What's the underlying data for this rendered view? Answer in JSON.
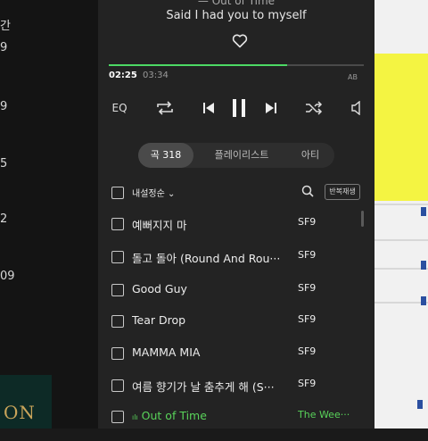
{
  "left_panel": {
    "partial_texts": [
      "간",
      "9",
      "9",
      "5",
      "2",
      "09"
    ],
    "cover_text": "ON"
  },
  "now_playing": {
    "lyric_top": "— Out of Time",
    "lyric": "Said I had you to myself",
    "progress": 0.7,
    "time_current": "02:25",
    "time_total": "03:34",
    "ab_label": "AB"
  },
  "controls": {
    "eq_label": "EQ",
    "icons": [
      "repeat-icon",
      "previous-icon",
      "pause-icon",
      "next-icon",
      "shuffle-icon",
      "volume-icon"
    ]
  },
  "tabs": [
    {
      "label": "곡 318",
      "active": true
    },
    {
      "label": "플레이리스트",
      "active": false
    },
    {
      "label": "아티",
      "active": false
    }
  ],
  "sort": {
    "label": "내설정순",
    "repeat_label": "반복재생"
  },
  "songs": [
    {
      "title": "예뻐지지 마",
      "artist": "SF9",
      "playing": false
    },
    {
      "title": "돌고 돌아 (Round And Rou···",
      "artist": "SF9",
      "playing": false
    },
    {
      "title": "Good Guy",
      "artist": "SF9",
      "playing": false
    },
    {
      "title": "Tear Drop",
      "artist": "SF9",
      "playing": false
    },
    {
      "title": "MAMMA MIA",
      "artist": "SF9",
      "playing": false
    },
    {
      "title": "여름 향기가 날 춤추게 해 (S···",
      "artist": "SF9",
      "playing": false
    },
    {
      "title": "Out of Time",
      "artist": "The Wee···",
      "playing": true
    }
  ],
  "colors": {
    "accent": "#59d35a",
    "background": "#232323"
  }
}
